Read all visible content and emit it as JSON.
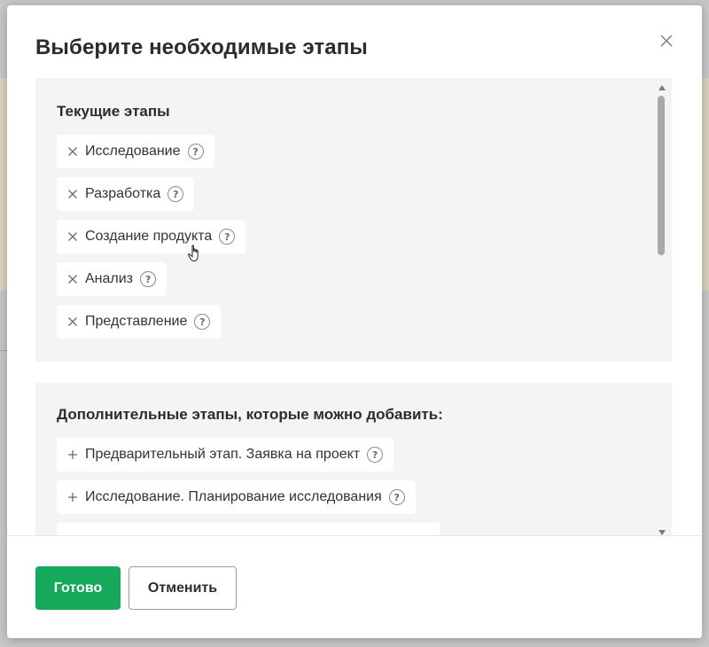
{
  "dialog": {
    "title": "Выберите необходимые этапы",
    "close_icon": "close-icon"
  },
  "current_section": {
    "title": "Текущие этапы",
    "items": [
      {
        "label": "Исследование",
        "icon": "remove-icon"
      },
      {
        "label": "Разработка",
        "icon": "remove-icon"
      },
      {
        "label": "Создание продукта",
        "icon": "remove-icon"
      },
      {
        "label": "Анализ",
        "icon": "remove-icon"
      },
      {
        "label": "Представление",
        "icon": "remove-icon"
      }
    ]
  },
  "additional_section": {
    "title": "Дополнительные этапы, которые можно добавить:",
    "items": [
      {
        "label": "Предварительный этап. Заявка на проект",
        "icon": "add-icon"
      },
      {
        "label": "Исследование. Планирование исследования",
        "icon": "add-icon"
      }
    ]
  },
  "help_glyph": "?",
  "footer": {
    "done_label": "Готово",
    "cancel_label": "Отменить"
  },
  "colors": {
    "primary": "#16a85b",
    "section_bg": "#f4f4f4",
    "text": "#2c2c2c"
  }
}
